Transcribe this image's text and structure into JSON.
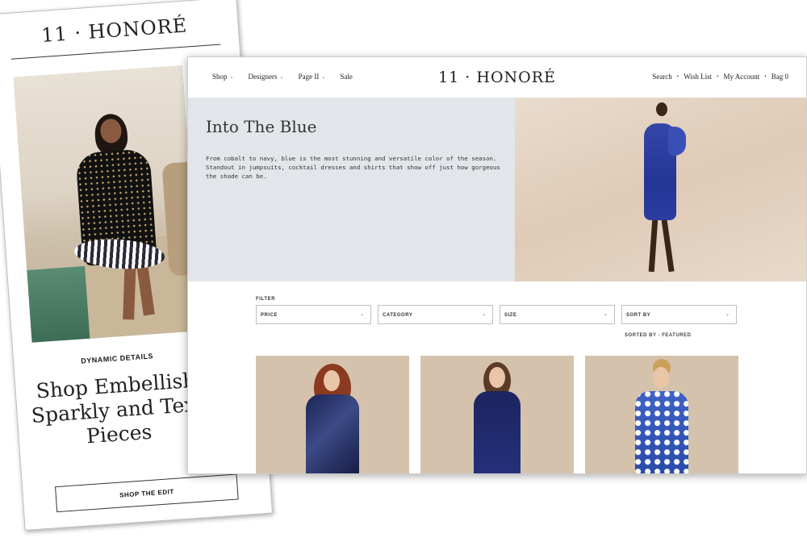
{
  "mobile": {
    "logo": "11 · HONORÉ",
    "kicker": "DYNAMIC DETAILS",
    "heading": "Shop Embellish\nSparkly and Text\nPieces",
    "button": "SHOP THE EDIT"
  },
  "desktop": {
    "nav": {
      "left": [
        {
          "label": "Shop",
          "caret": "⌄"
        },
        {
          "label": "Designers",
          "caret": "⌄"
        },
        {
          "label": "Page II",
          "caret": "⌄"
        },
        {
          "label": "Sale",
          "caret": ""
        }
      ],
      "logo": "11 · HONORÉ",
      "search": "Search",
      "wishlist": "Wish List",
      "account": "My Account",
      "bag": "Bag",
      "bag_count": "0"
    },
    "hero": {
      "title": "Into The Blue",
      "body": "From cobalt to navy, blue is the most stunning and versatile color of the season. Standout in jumpsuits, cocktail dresses and shirts that show off just how gorgeous the shade can be."
    },
    "filter": {
      "label": "FILTER",
      "selects": [
        "PRICE",
        "CATEGORY",
        "SIZE",
        "SORT BY"
      ],
      "sorted_by": "SORTED BY - FEATURED"
    },
    "colors": {
      "hero_text_bg": "#e2e6ea",
      "product_bg": "#d5c2ad",
      "cobalt": "#2a3ca0",
      "navy": "#1d2557"
    }
  }
}
